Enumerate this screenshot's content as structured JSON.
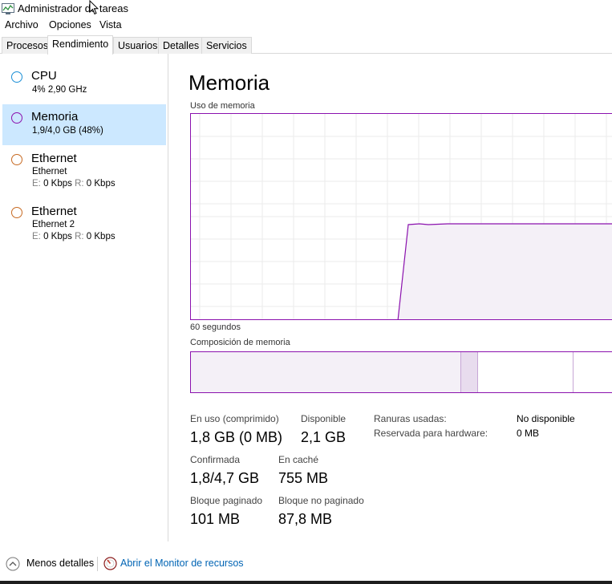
{
  "window": {
    "title": "Administrador de tareas"
  },
  "menu": [
    "Archivo",
    "Opciones",
    "Vista"
  ],
  "tabs": [
    "Procesos",
    "Rendimiento",
    "Usuarios",
    "Detalles",
    "Servicios"
  ],
  "active_tab": "Rendimiento",
  "sidebar": {
    "items": [
      {
        "title": "CPU",
        "sub": "4%  2,90 GHz",
        "color": "#1b8fd6"
      },
      {
        "title": "Memoria",
        "sub": "1,9/4,0 GB (48%)",
        "color": "#8b12ae"
      },
      {
        "title": "Ethernet",
        "sub": "Ethernet",
        "send_label": "E:",
        "send_value": "0 Kbps",
        "recv_label": "R:",
        "recv_value": "0 Kbps",
        "color": "#a74f01"
      },
      {
        "title": "Ethernet",
        "sub": "Ethernet 2",
        "send_label": "E:",
        "send_value": "0 Kbps",
        "recv_label": "R:",
        "recv_value": "0 Kbps",
        "color": "#a74f01"
      }
    ]
  },
  "main": {
    "title": "Memoria",
    "graph_label": "Uso de memoria",
    "time_label": "60 segundos",
    "composition_label": "Composición de memoria"
  },
  "stats": {
    "in_use_label": "En uso (comprimido)",
    "in_use_value": "1,8 GB (0 MB)",
    "available_label": "Disponible",
    "available_value": "2,1 GB",
    "committed_label": "Confirmada",
    "committed_value": "1,8/4,7 GB",
    "cached_label": "En caché",
    "cached_value": "755 MB",
    "paged_label": "Bloque paginado",
    "paged_value": "101 MB",
    "nonpaged_label": "Bloque no paginado",
    "nonpaged_value": "87,8 MB",
    "slots_label": "Ranuras usadas:",
    "slots_value": "No disponible",
    "reserved_label": "Reservada para hardware:",
    "reserved_value": "0 MB"
  },
  "footer": {
    "less_details": "Menos detalles",
    "resource_monitor": "Abrir el Monitor de recursos"
  },
  "colors": {
    "accent": "#8b12ae",
    "selection": "#cce8ff",
    "link": "#0064b4"
  }
}
